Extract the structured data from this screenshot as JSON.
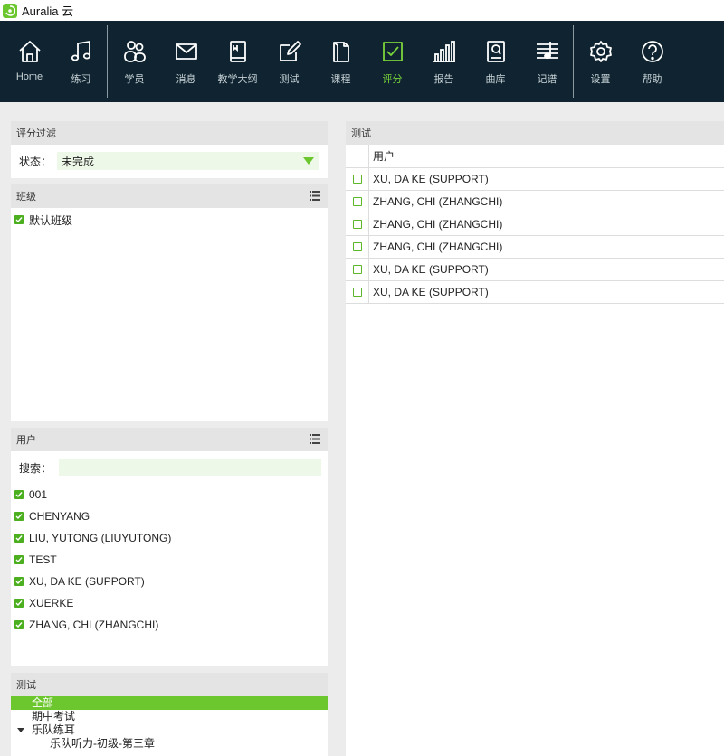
{
  "app": {
    "title": "Auralia 云",
    "logo_icon": "auralia-logo-icon"
  },
  "toolbar": {
    "items": [
      {
        "label": "Home",
        "icon": "home-icon"
      },
      {
        "label": "练习",
        "icon": "music-note-icon"
      },
      {
        "label": "学员",
        "icon": "users-icon"
      },
      {
        "label": "消息",
        "icon": "envelope-icon"
      },
      {
        "label": "教学大纲",
        "icon": "book-icon"
      },
      {
        "label": "测试",
        "icon": "edit-icon"
      },
      {
        "label": "课程",
        "icon": "document-icon"
      },
      {
        "label": "评分",
        "icon": "checkbox-icon"
      },
      {
        "label": "报告",
        "icon": "bar-chart-icon"
      },
      {
        "label": "曲库",
        "icon": "library-icon"
      },
      {
        "label": "记谱",
        "icon": "staff-icon"
      },
      {
        "label": "设置",
        "icon": "gear-icon"
      },
      {
        "label": "帮助",
        "icon": "help-icon"
      }
    ],
    "active": "评分",
    "accent_color": "#7ad43b"
  },
  "filter_panel": {
    "title": "评分过滤",
    "status_label": "状态：",
    "status_value": "未完成"
  },
  "class_panel": {
    "title": "班级",
    "items": [
      {
        "label": "默认班级",
        "checked": true
      }
    ]
  },
  "user_panel": {
    "title": "用户",
    "search_label": "搜索：",
    "search_value": "",
    "items": [
      {
        "label": "001",
        "checked": true
      },
      {
        "label": "CHENYANG",
        "checked": true
      },
      {
        "label": "LIU, YUTONG (LIUYUTONG)",
        "checked": true
      },
      {
        "label": "TEST",
        "checked": true
      },
      {
        "label": "XU, DA KE (SUPPORT)",
        "checked": true
      },
      {
        "label": "XUERKE",
        "checked": true
      },
      {
        "label": "ZHANG, CHI (ZHANGCHI)",
        "checked": true
      }
    ]
  },
  "test_panel": {
    "title": "测试",
    "tree": [
      {
        "label": "全部",
        "selected": true
      },
      {
        "label": "期中考试"
      },
      {
        "label": "乐队练耳",
        "expanded": true
      },
      {
        "label": "乐队听力-初级-第三章"
      }
    ]
  },
  "results_panel": {
    "title": "测试",
    "column_user": "用户",
    "rows": [
      {
        "user": "XU, DA KE (SUPPORT)",
        "checked": false
      },
      {
        "user": "ZHANG, CHI (ZHANGCHI)",
        "checked": false
      },
      {
        "user": "ZHANG, CHI (ZHANGCHI)",
        "checked": false
      },
      {
        "user": "ZHANG, CHI (ZHANGCHI)",
        "checked": false
      },
      {
        "user": "XU, DA KE (SUPPORT)",
        "checked": false
      },
      {
        "user": "XU, DA KE (SUPPORT)",
        "checked": false
      }
    ]
  }
}
